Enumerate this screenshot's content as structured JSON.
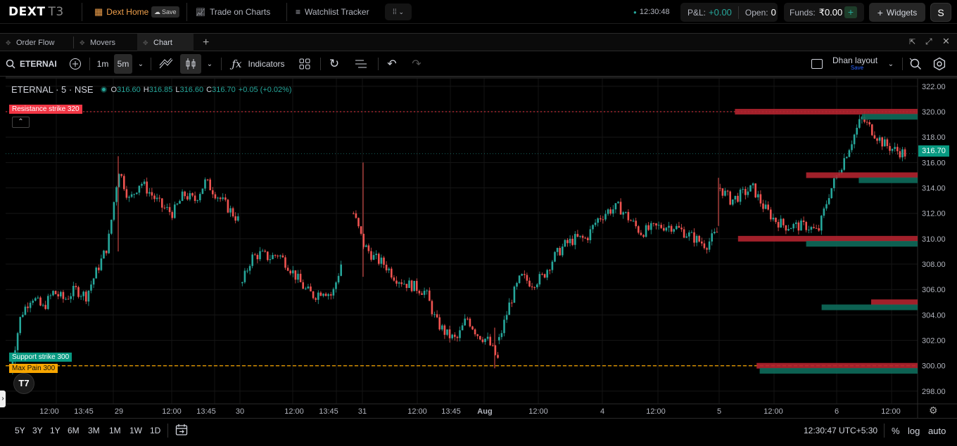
{
  "topbar": {
    "logo_main": "DEXT",
    "logo_sub": "T3",
    "home_label": "Dext Home",
    "save_label": "Save",
    "trade_label": "Trade on Charts",
    "watchlist_label": "Watchlist Tracker",
    "clock": "12:30:48",
    "pnl_label": "P&L:",
    "pnl_value": "+0.00",
    "open_label": "Open:",
    "open_value": "0",
    "funds_label": "Funds:",
    "funds_value": "₹0.00",
    "funds_add": "+",
    "widgets_label": "Widgets",
    "avatar_letter": "S"
  },
  "tabs": [
    {
      "label": "Order Flow"
    },
    {
      "label": "Movers"
    },
    {
      "label": "Chart"
    }
  ],
  "toolbar": {
    "symbol": "ETERNAI",
    "interval_1m": "1m",
    "interval_5m": "5m",
    "indicators_label": "Indicators",
    "layout_name": "Dhan layout",
    "layout_save": "Save"
  },
  "legend": {
    "title": "ETERNAL · 5 · NSE",
    "o_label": "O",
    "o_value": "316.60",
    "h_label": "H",
    "h_value": "316.85",
    "l_label": "L",
    "l_value": "316.60",
    "c_label": "C",
    "c_value": "316.70",
    "change": "+0.05 (+0.02%)"
  },
  "annotations": {
    "resistance": "Resistance strike 320",
    "support": "Support strike 300",
    "maxpain": "Max Pain 300",
    "last_price": "316.70"
  },
  "bottombar": {
    "ranges": [
      "5Y",
      "3Y",
      "1Y",
      "6M",
      "3M",
      "1M",
      "1W",
      "1D"
    ],
    "time": "12:30:47 UTC+5:30",
    "percent": "%",
    "log": "log",
    "auto": "auto"
  },
  "colors": {
    "up": "#26a69a",
    "down": "#ef5350",
    "resistance": "#f23645",
    "support": "#089981",
    "maxpain": "#f7a600"
  },
  "chart_data": {
    "type": "candlestick",
    "symbol": "ETERNAL",
    "interval": "5",
    "exchange": "NSE",
    "ylim": [
      297,
      322.6
    ],
    "y_ticks": [
      "322.00",
      "320.00",
      "318.00",
      "316.00",
      "314.00",
      "312.00",
      "310.00",
      "308.00",
      "306.00",
      "304.00",
      "302.00",
      "300.00",
      "298.00"
    ],
    "x_ticks": [
      "12:00",
      "13:45",
      "29",
      "12:00",
      "13:45",
      "30",
      "12:00",
      "13:45",
      "31",
      "12:00",
      "13:45",
      "Aug",
      "12:00",
      "4",
      "12:00",
      "5",
      "12:00",
      "6",
      "12:00"
    ],
    "price_path": [
      [
        0,
        299.5
      ],
      [
        1,
        304
      ],
      [
        2,
        305.5
      ],
      [
        3,
        304.5
      ],
      [
        4,
        305.8
      ],
      [
        5,
        305.2
      ],
      [
        6,
        306
      ],
      [
        7,
        305.5
      ],
      [
        8,
        307.5
      ],
      [
        9,
        309.5
      ],
      [
        10,
        315.5
      ],
      [
        11,
        313
      ],
      [
        12,
        314.5
      ],
      [
        13,
        313.5
      ],
      [
        14,
        312.5
      ],
      [
        15,
        312
      ],
      [
        16,
        313.5
      ],
      [
        17,
        313
      ],
      [
        18,
        314.5
      ],
      [
        19,
        313.5
      ],
      [
        20,
        312.5
      ],
      [
        21,
        311.5
      ],
      [
        22,
        306.5
      ],
      [
        23,
        308.5
      ],
      [
        24,
        308.8
      ],
      [
        25,
        308.5
      ],
      [
        26,
        308.8
      ],
      [
        27,
        308
      ],
      [
        28,
        307
      ],
      [
        29,
        306
      ],
      [
        30,
        305.5
      ],
      [
        31,
        306
      ],
      [
        32,
        305.5
      ],
      [
        33,
        308
      ],
      [
        34,
        312
      ],
      [
        35,
        309.5
      ],
      [
        36,
        308.5
      ],
      [
        37,
        308
      ],
      [
        38,
        307
      ],
      [
        39,
        306.5
      ],
      [
        40,
        306.2
      ],
      [
        41,
        305.8
      ],
      [
        42,
        303.5
      ],
      [
        43,
        302.5
      ],
      [
        44,
        302
      ],
      [
        45,
        303.8
      ],
      [
        46,
        302.5
      ],
      [
        47,
        302
      ],
      [
        48,
        300.5
      ],
      [
        49,
        302
      ],
      [
        50,
        305
      ],
      [
        51,
        307
      ],
      [
        52,
        306.5
      ],
      [
        53,
        307
      ],
      [
        54,
        308.5
      ],
      [
        55,
        309.5
      ],
      [
        56,
        310
      ],
      [
        57,
        310
      ],
      [
        58,
        311.5
      ],
      [
        59,
        312.2
      ],
      [
        60,
        312.5
      ],
      [
        61,
        311.5
      ],
      [
        62,
        310.5
      ],
      [
        63,
        310.8
      ],
      [
        64,
        311
      ],
      [
        65,
        311
      ],
      [
        66,
        310.5
      ],
      [
        67,
        310
      ],
      [
        68,
        309.5
      ],
      [
        69,
        310.5
      ],
      [
        70,
        314
      ],
      [
        71,
        313
      ],
      [
        72,
        313.5
      ],
      [
        73,
        314
      ],
      [
        74,
        312.5
      ],
      [
        75,
        311.5
      ],
      [
        76,
        311
      ],
      [
        77,
        311
      ],
      [
        78,
        311
      ],
      [
        79,
        310.5
      ],
      [
        80,
        313.5
      ],
      [
        81,
        315.5
      ],
      [
        82,
        317.5
      ],
      [
        83,
        319.5
      ],
      [
        84,
        318.5
      ],
      [
        85,
        317.5
      ],
      [
        86,
        317
      ],
      [
        87,
        316.7
      ]
    ],
    "oi_bars": [
      {
        "price": 320,
        "side": "put",
        "value": 0.59
      },
      {
        "price": 319.6,
        "side": "call",
        "value": 0.18
      },
      {
        "price": 315,
        "side": "put",
        "value": 0.36
      },
      {
        "price": 314.6,
        "side": "call",
        "value": 0.19
      },
      {
        "price": 310,
        "side": "put",
        "value": 0.58
      },
      {
        "price": 309.6,
        "side": "call",
        "value": 0.36
      },
      {
        "price": 305,
        "side": "put",
        "value": 0.15
      },
      {
        "price": 304.6,
        "side": "call",
        "value": 0.31
      },
      {
        "price": 300,
        "side": "put",
        "value": 0.52
      },
      {
        "price": 299.6,
        "side": "call",
        "value": 0.51
      }
    ],
    "levels": {
      "resistance": 320,
      "support": 300,
      "max_pain": 300,
      "last": 316.7
    }
  }
}
